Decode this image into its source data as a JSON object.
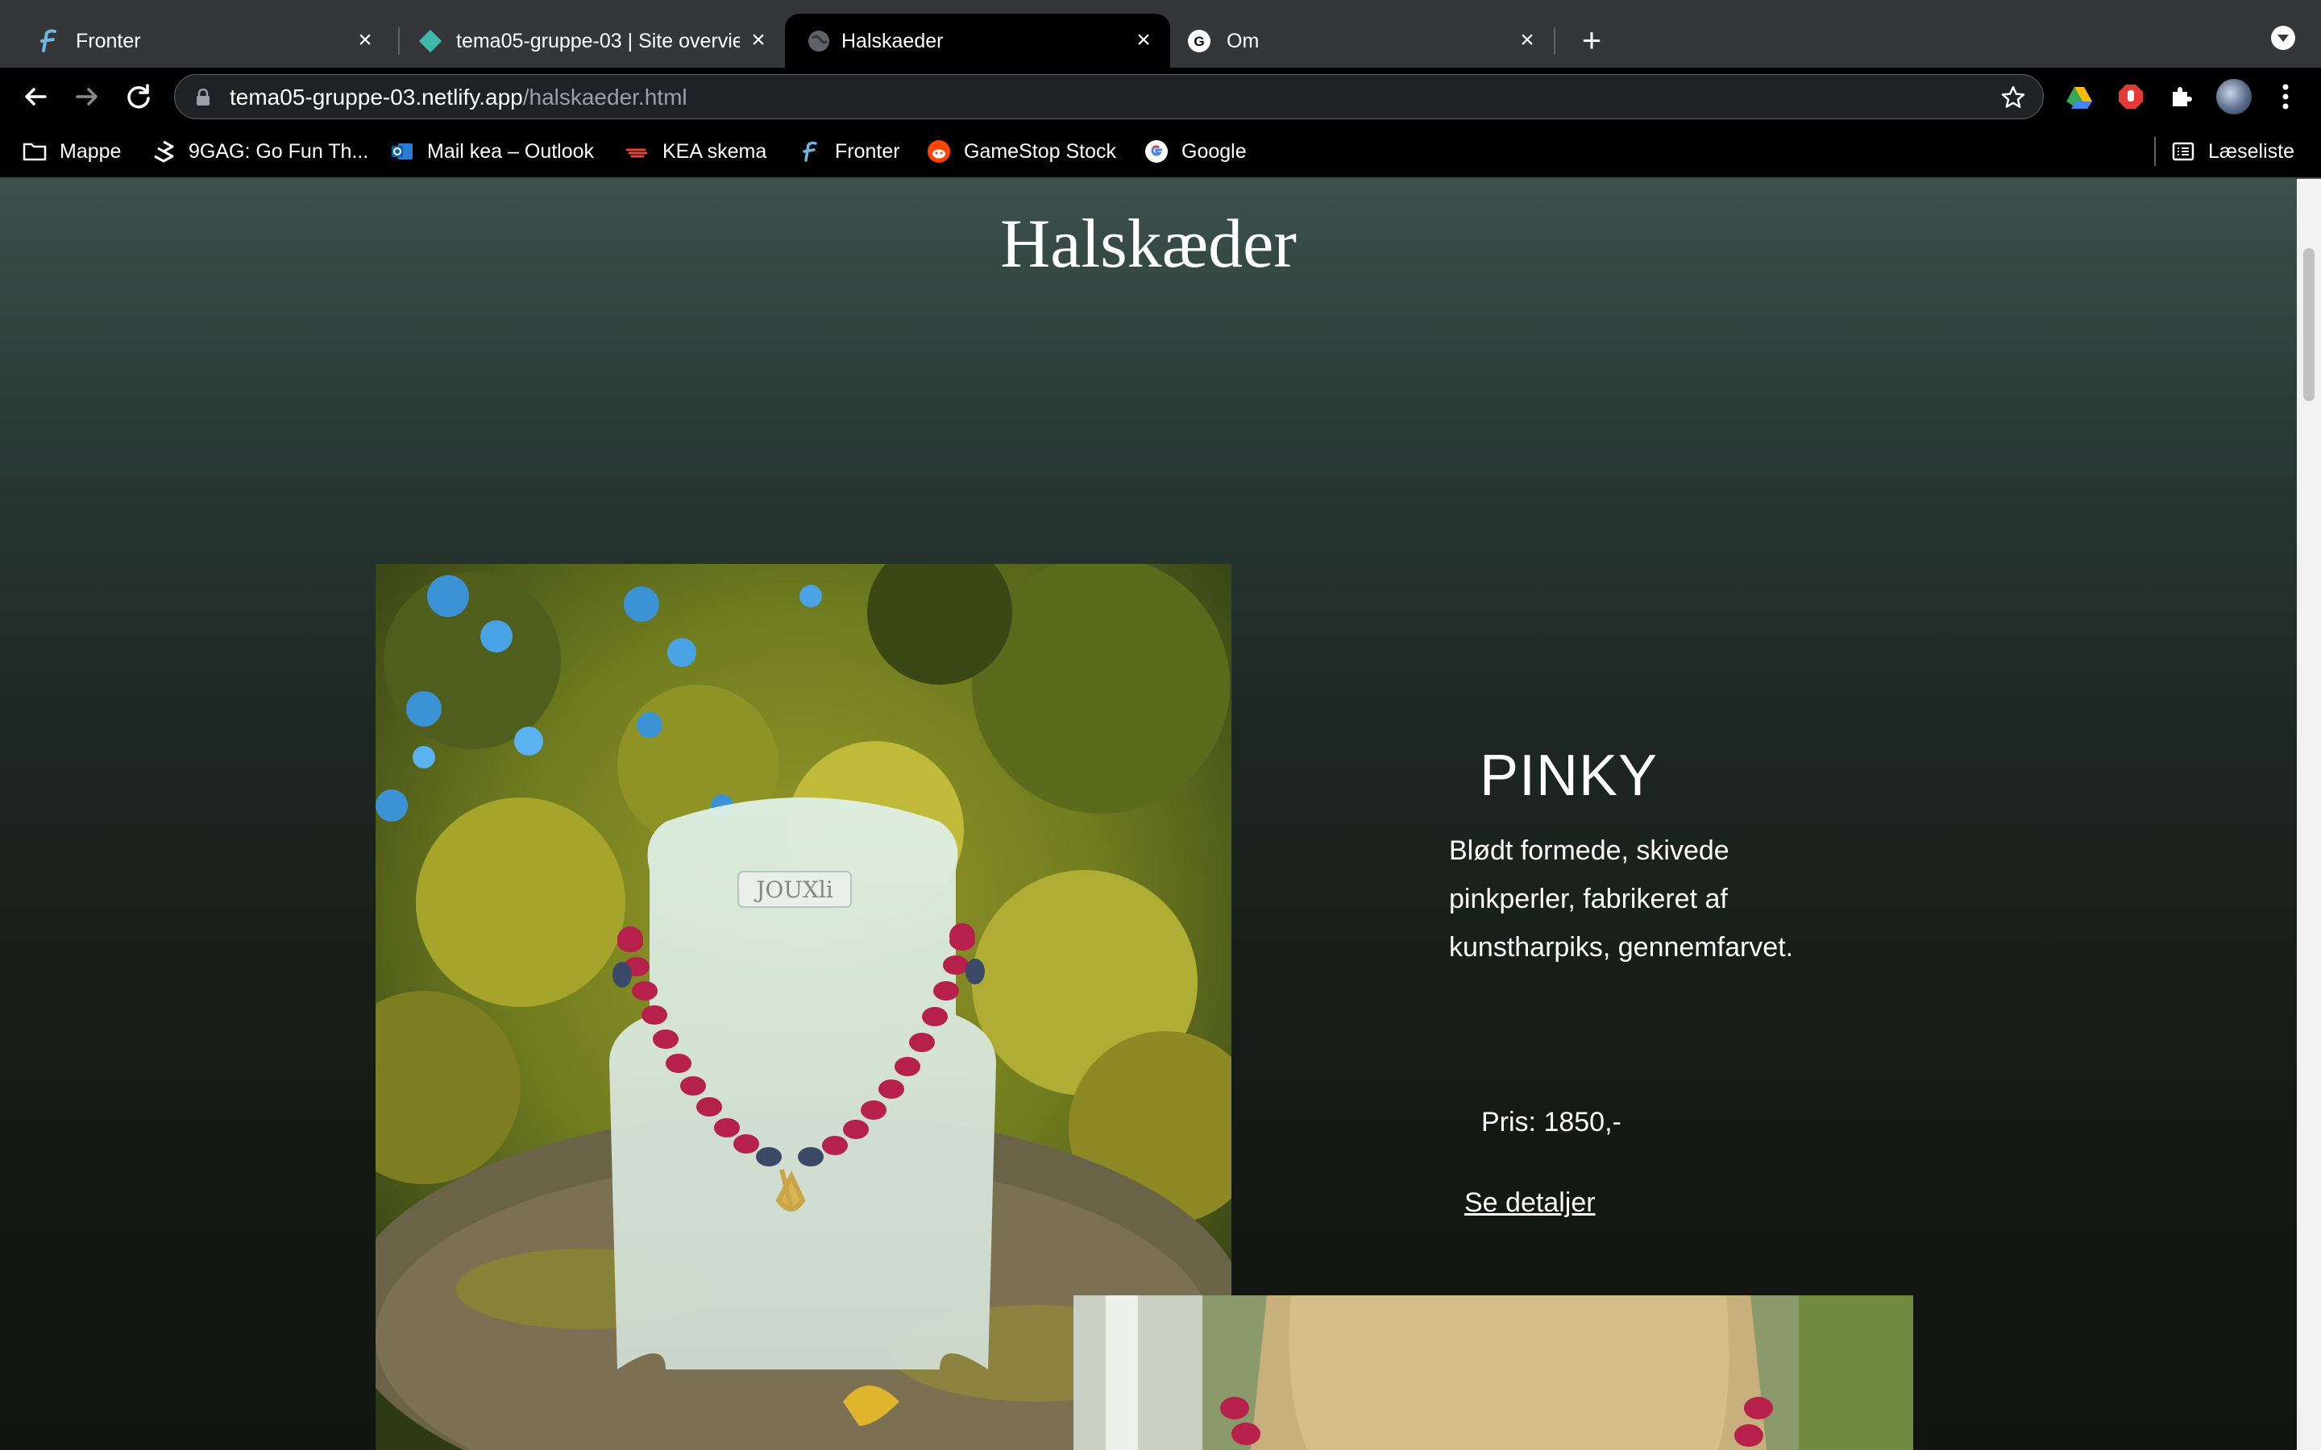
{
  "browser": {
    "tabs": [
      {
        "title": "Fronter",
        "active": false,
        "icon": "fronter-icon"
      },
      {
        "title": "tema05-gruppe-03 | Site overview",
        "active": false,
        "icon": "netlify-icon"
      },
      {
        "title": "Halskaeder",
        "active": true,
        "icon": "globe-icon"
      },
      {
        "title": "Om",
        "active": false,
        "icon": "github-icon"
      }
    ],
    "url_host": "tema05-gruppe-03.netlify.app",
    "url_path": "/halskaeder.html",
    "bookmarks": [
      {
        "label": "Mappe",
        "icon": "folder-icon"
      },
      {
        "label": "9GAG: Go Fun Th...",
        "icon": "ninegag-icon"
      },
      {
        "label": "Mail kea – Outlook",
        "icon": "outlook-icon"
      },
      {
        "label": "KEA skema",
        "icon": "kea-icon"
      },
      {
        "label": "Fronter",
        "icon": "fronter-icon"
      },
      {
        "label": "GameStop Stock",
        "icon": "reddit-icon"
      },
      {
        "label": "Google",
        "icon": "google-icon"
      }
    ],
    "reading_list": "Læseliste"
  },
  "page": {
    "title": "Halskæder",
    "product": {
      "name": "PINKY",
      "description": "Blødt formede, skivede pinkperler, fabrikeret af kunstharpiks, gennemfarvet.",
      "price": "Pris: 1850,-",
      "details_link": "Se detaljer",
      "image_label": "JOUXli"
    }
  },
  "colors": {
    "tabstrip": "#35363a",
    "toolbar": "#000000",
    "page_top": "#3b514b",
    "page_bottom": "#111411",
    "bead_red": "#b5214a"
  }
}
